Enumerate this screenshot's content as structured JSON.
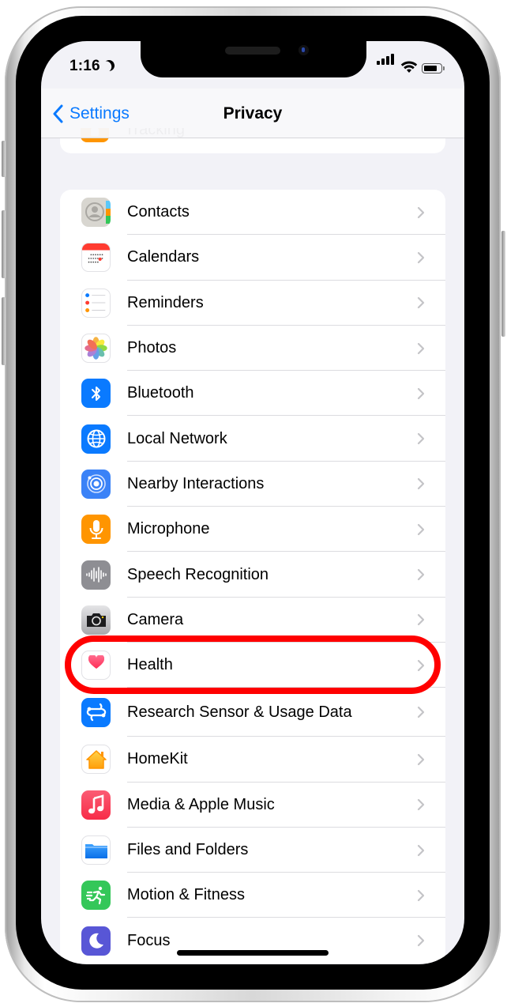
{
  "status_bar": {
    "time": "1:16",
    "focus_icon": "moon-icon",
    "signal_icon": "cellular-signal-icon",
    "wifi_icon": "wifi-icon",
    "battery_icon": "battery-icon"
  },
  "nav": {
    "back_label": "Settings",
    "back_icon": "chevron-left-icon",
    "title": "Privacy"
  },
  "previous_row": {
    "label": "Tracking",
    "icon": "tracking-icon",
    "color": "#ff9500"
  },
  "list": {
    "items": [
      {
        "label": "Contacts",
        "icon": "contacts-icon"
      },
      {
        "label": "Calendars",
        "icon": "calendar-icon"
      },
      {
        "label": "Reminders",
        "icon": "reminders-icon"
      },
      {
        "label": "Photos",
        "icon": "photos-icon"
      },
      {
        "label": "Bluetooth",
        "icon": "bluetooth-icon",
        "color": "#0a7aff"
      },
      {
        "label": "Local Network",
        "icon": "globe-icon",
        "color": "#0a7aff"
      },
      {
        "label": "Nearby Interactions",
        "icon": "nearby-interactions-icon",
        "color": "#3a82f7"
      },
      {
        "label": "Microphone",
        "icon": "microphone-icon",
        "color": "#ff9500"
      },
      {
        "label": "Speech Recognition",
        "icon": "waveform-icon",
        "color": "#8e8e93"
      },
      {
        "label": "Camera",
        "icon": "camera-icon",
        "color": "#3a3a3c"
      },
      {
        "label": "Health",
        "icon": "heart-icon",
        "highlighted": true
      },
      {
        "label": "Research Sensor & Usage Data",
        "icon": "research-icon",
        "color": "#0a7aff"
      },
      {
        "label": "HomeKit",
        "icon": "home-icon"
      },
      {
        "label": "Media & Apple Music",
        "icon": "music-note-icon",
        "color": "#fa3c52"
      },
      {
        "label": "Files and Folders",
        "icon": "folder-icon"
      },
      {
        "label": "Motion & Fitness",
        "icon": "running-figure-icon",
        "color": "#34c759"
      },
      {
        "label": "Focus",
        "icon": "moon-icon",
        "color": "#5856d6"
      }
    ]
  },
  "annotation": {
    "highlight_color": "#ff0000",
    "highlighted_item": "Health"
  },
  "colors": {
    "accent": "#0a7aff",
    "background": "#f2f2f7",
    "chevron": "#c4c4c7"
  }
}
